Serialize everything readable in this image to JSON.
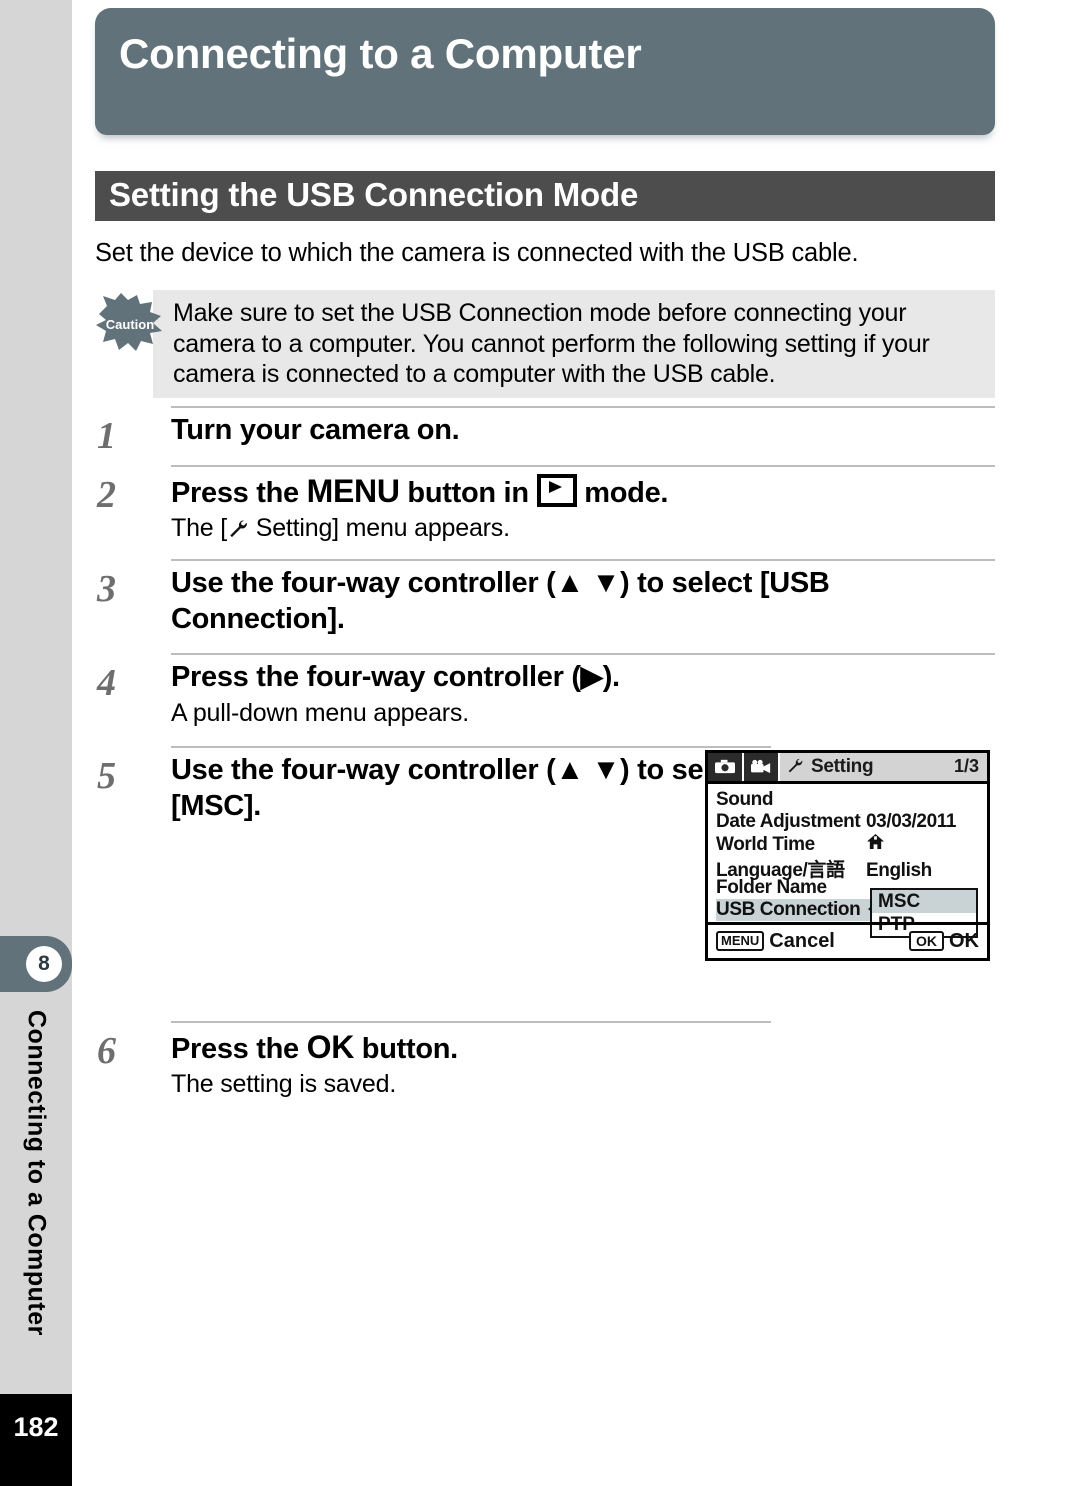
{
  "sidebar": {
    "chapter_number": "8",
    "chapter_title": "Connecting to a Computer",
    "page_number": "182"
  },
  "header": {
    "chapter_banner_title": "Connecting to a Computer",
    "section_title": "Setting the USB Connection Mode",
    "banner_color": "#61727a",
    "section_bar_color": "#4d4d4d"
  },
  "intro": {
    "text": "Set the device to which the camera is connected with the USB cable."
  },
  "caution": {
    "badge_label": "Caution",
    "text": "Make sure to set the USB Connection mode before connecting your camera to a computer. You cannot perform the following setting if your camera is connected to a computer with the USB cable."
  },
  "steps": [
    {
      "number": "1",
      "title": "Turn your camera on.",
      "description": ""
    },
    {
      "number": "2",
      "title_pre": "Press the ",
      "title_menu": "MENU",
      "title_mid": " button in ",
      "title_post": " mode.",
      "description_pre": "The [",
      "description_post": " Setting] menu appears."
    },
    {
      "number": "3",
      "title": "Use the four-way controller (▲ ▼) to select [USB Connection].",
      "description": ""
    },
    {
      "number": "4",
      "title": "Press the four-way controller (▶).",
      "description": "A pull-down menu appears."
    },
    {
      "number": "5",
      "title": "Use the four-way controller (▲ ▼) to select [MSC].",
      "description": ""
    },
    {
      "number": "6",
      "title_pre": "Press the ",
      "title_ok": "OK",
      "title_post": " button.",
      "description": "The setting is saved."
    }
  ],
  "lcd": {
    "tabs": [
      "still-camera-tab",
      "movie-camera-tab"
    ],
    "active_tab_label": "Setting",
    "page_indicator": "1/3",
    "menu_items": [
      {
        "label": "Sound",
        "value": ""
      },
      {
        "label": "Date Adjustment",
        "value": "03/03/2011"
      },
      {
        "label": "World Time",
        "value": "home-icon"
      },
      {
        "label": "Language/言語",
        "value": "English"
      },
      {
        "label": "Folder Name",
        "value": ""
      },
      {
        "label": "USB Connection",
        "value": ""
      }
    ],
    "selected_item": "USB Connection",
    "dropdown": {
      "options": [
        "MSC",
        "PTP"
      ],
      "selected": "MSC"
    },
    "footer": {
      "cancel_key": "MENU",
      "cancel_label": "Cancel",
      "ok_key": "OK",
      "ok_label": "OK"
    },
    "highlight_color": "#c9d3d6"
  }
}
